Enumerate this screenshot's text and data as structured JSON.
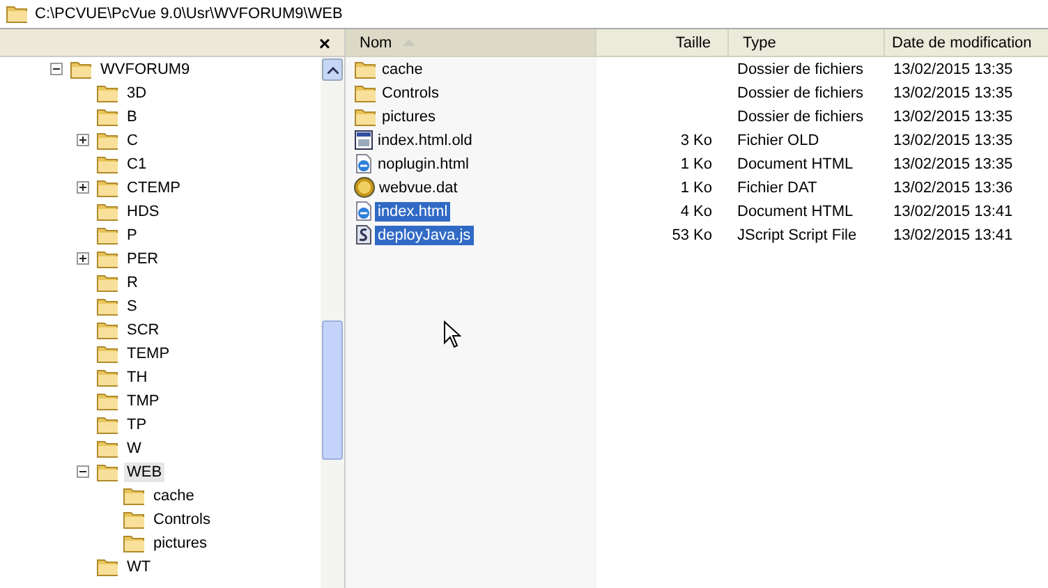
{
  "address_bar": {
    "path": "C:\\PCVUE\\PcVue 9.0\\Usr\\WVFORUM9\\WEB"
  },
  "folder_pane": {
    "close": "×",
    "tree": [
      {
        "label": "WVFORUM9",
        "expanded": true,
        "selected": false,
        "children": [
          {
            "label": "3D",
            "selected": false
          },
          {
            "label": "B",
            "selected": false
          },
          {
            "label": "C",
            "expanded": false,
            "selected": false
          },
          {
            "label": "C1",
            "selected": false
          },
          {
            "label": "CTEMP",
            "expanded": false,
            "selected": false
          },
          {
            "label": "HDS",
            "selected": false
          },
          {
            "label": "P",
            "selected": false
          },
          {
            "label": "PER",
            "expanded": false,
            "selected": false
          },
          {
            "label": "R",
            "selected": false
          },
          {
            "label": "S",
            "selected": false
          },
          {
            "label": "SCR",
            "selected": false
          },
          {
            "label": "TEMP",
            "selected": false
          },
          {
            "label": "TH",
            "selected": false
          },
          {
            "label": "TMP",
            "selected": false
          },
          {
            "label": "TP",
            "selected": false
          },
          {
            "label": "W",
            "selected": false
          },
          {
            "label": "WEB",
            "expanded": true,
            "selected": true,
            "children": [
              {
                "label": "cache",
                "selected": false
              },
              {
                "label": "Controls",
                "selected": false
              },
              {
                "label": "pictures",
                "selected": false
              }
            ]
          },
          {
            "label": "WT",
            "selected": false
          }
        ]
      }
    ]
  },
  "file_list": {
    "columns": [
      {
        "label": "Nom",
        "sorted": true
      },
      {
        "label": "Taille",
        "sorted": false
      },
      {
        "label": "Type",
        "sorted": false
      },
      {
        "label": "Date de modification",
        "sorted": false
      }
    ],
    "rows": [
      {
        "kind": "folder",
        "name": "cache",
        "size": "",
        "type": "Dossier de fichiers",
        "modified": "13/02/2015 13:35",
        "selected": false
      },
      {
        "kind": "folder",
        "name": "Controls",
        "size": "",
        "type": "Dossier de fichiers",
        "modified": "13/02/2015 13:35",
        "selected": false
      },
      {
        "kind": "folder",
        "name": "pictures",
        "size": "",
        "type": "Dossier de fichiers",
        "modified": "13/02/2015 13:35",
        "selected": false
      },
      {
        "kind": "old",
        "name": "index.html.old",
        "size": "3 Ko",
        "type": "Fichier OLD",
        "modified": "13/02/2015 13:35",
        "selected": false
      },
      {
        "kind": "html",
        "name": "noplugin.html",
        "size": "1 Ko",
        "type": "Document HTML",
        "modified": "13/02/2015 13:35",
        "selected": false
      },
      {
        "kind": "dat",
        "name": "webvue.dat",
        "size": "1 Ko",
        "type": "Fichier DAT",
        "modified": "13/02/2015 13:36",
        "selected": false
      },
      {
        "kind": "html",
        "name": "index.html",
        "size": "4 Ko",
        "type": "Document HTML",
        "modified": "13/02/2015 13:41",
        "selected": true
      },
      {
        "kind": "js",
        "name": "deployJava.js",
        "size": "53 Ko",
        "type": "JScript Script File",
        "modified": "13/02/2015 13:41",
        "selected": true
      }
    ]
  }
}
